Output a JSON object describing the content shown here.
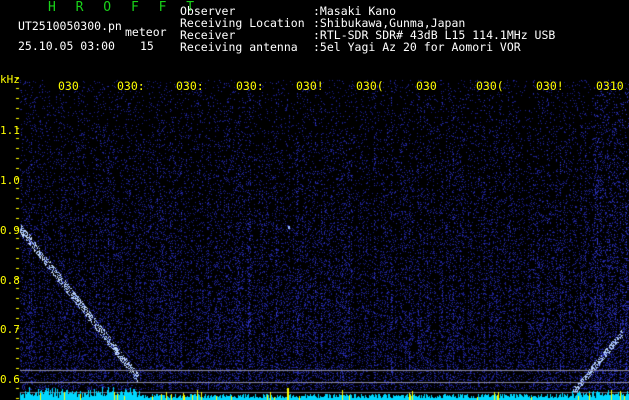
{
  "app": {
    "title": "H R O F F T"
  },
  "file": {
    "name": "UT2510050300.pn",
    "tag": "meteor",
    "datetime": "25.10.05 03:00",
    "count": "15"
  },
  "info": [
    {
      "label": "Observer",
      "value": ":Masaki Kano"
    },
    {
      "label": "Receiving Location",
      "value": ":Shibukawa,Gunma,Japan"
    },
    {
      "label": "Receiver",
      "value": ":RTL-SDR SDR# 43dB L15 114.1MHz USB"
    },
    {
      "label": "Receiving antenna",
      "value": ":5el Yagi Az 20 for Aomori VOR"
    }
  ],
  "axis": {
    "y_unit": "kHz",
    "y_labels": [
      "1.1",
      "1.0",
      "0.9",
      "0.8",
      "0.7",
      "0.6"
    ],
    "x_labels": [
      "030",
      "030:",
      "030:",
      "030:",
      "030!",
      "030(",
      "030",
      "030(",
      "030!",
      "0310"
    ]
  },
  "colors": {
    "background": "#000000",
    "noise": "#1a1f8a",
    "signal": "#7fa8ff",
    "ticks": "#ffff00",
    "baseline": "#00e5ff"
  }
}
